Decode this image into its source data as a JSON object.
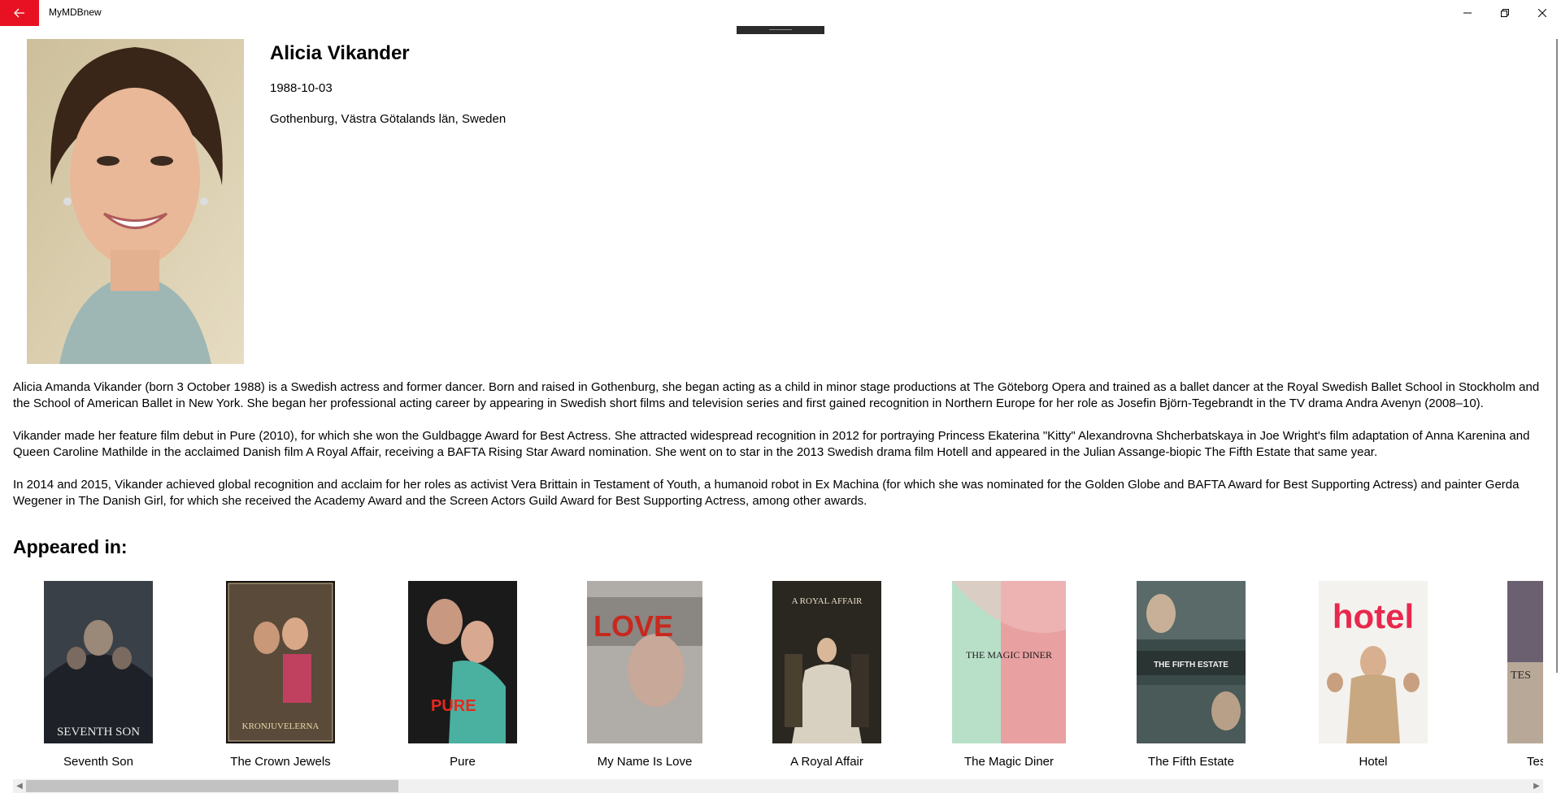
{
  "app": {
    "title": "MyMDBnew"
  },
  "person": {
    "name": "Alicia Vikander",
    "birthday": "1988-10-03",
    "birthplace": "Gothenburg, Västra Götalands län, Sweden"
  },
  "bio": [
    "Alicia Amanda Vikander (born 3 October 1988) is a Swedish actress and former dancer. Born and raised in Gothenburg, she began acting as a child in minor stage productions at The Göteborg Opera and trained as a ballet dancer at the Royal Swedish Ballet School in Stockholm and the School of American Ballet in New York. She began her professional acting career by appearing in Swedish short films and television series and first gained recognition in Northern Europe for her role as Josefin Björn-Tegebrandt in the TV drama Andra Avenyn (2008–10).",
    "Vikander made her feature film debut in Pure (2010), for which she won the Guldbagge Award for Best Actress. She attracted widespread recognition in 2012 for portraying Princess Ekaterina \"Kitty\" Alexandrovna Shcherbatskaya in Joe Wright's film adaptation of Anna Karenina and Queen Caroline Mathilde in the acclaimed Danish film A Royal Affair, receiving a BAFTA Rising Star Award nomination. She went on to star in the 2013 Swedish drama film Hotell and appeared in the Julian Assange-biopic The Fifth Estate that same year.",
    "In 2014 and 2015, Vikander achieved global recognition and acclaim for her roles as activist Vera Brittain in Testament of Youth, a humanoid robot in Ex Machina (for which she was nominated for the Golden Globe and BAFTA Award for Best Supporting Actress) and painter Gerda Wegener in The Danish Girl, for which she received the Academy Award and the Screen Actors Guild Award for Best Supporting Actress, among other awards."
  ],
  "appeared_heading": "Appeared in:",
  "movies": [
    {
      "title": "Seventh Son",
      "poster_text": "SEVENTH SON",
      "bg": "#3a4048"
    },
    {
      "title": "The Crown Jewels",
      "poster_text": "KRONJUVELERNA",
      "bg": "#5a4a3a"
    },
    {
      "title": "Pure",
      "poster_text": "PURE",
      "bg": "#2a2a2a"
    },
    {
      "title": "My Name Is Love",
      "poster_text": "LOVE",
      "bg": "#b0aca8"
    },
    {
      "title": "A Royal Affair",
      "poster_text": "A ROYAL AFFAIR",
      "bg": "#2a2620"
    },
    {
      "title": "The Magic Diner",
      "poster_text": "THE MAGIC DINER",
      "bg": "#e8a0a0"
    },
    {
      "title": "The Fifth Estate",
      "poster_text": "THE FIFTH ESTATE",
      "bg": "#3a4a48"
    },
    {
      "title": "Hotel",
      "poster_text": "hotel",
      "bg": "#f4f2ee"
    },
    {
      "title": "Testament of Youth",
      "poster_text": "TES",
      "bg": "#6a6070"
    }
  ],
  "colors": {
    "back_button": "#e81123",
    "scroll_thumb": "#c2c2c2"
  },
  "icons": {
    "back": "arrow-left-icon",
    "minimize": "minimize-icon",
    "maximize": "restore-icon",
    "close": "close-icon"
  }
}
